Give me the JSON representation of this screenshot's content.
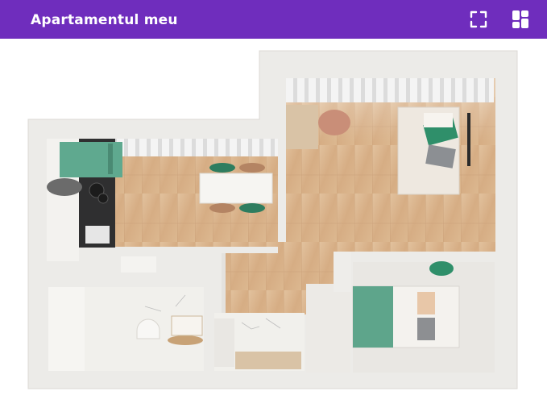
{
  "app": {
    "title": "Apartamentul meu"
  },
  "toolbar": {
    "fullscreen_icon": "fullscreen-icon",
    "grid_icon": "grid-view-icon"
  },
  "colors": {
    "header": "#6f2dbd",
    "wall": "#ecebe8",
    "floor": "#d9b48c",
    "teal": "#5fa98f",
    "tile": "#f1f0ec"
  }
}
